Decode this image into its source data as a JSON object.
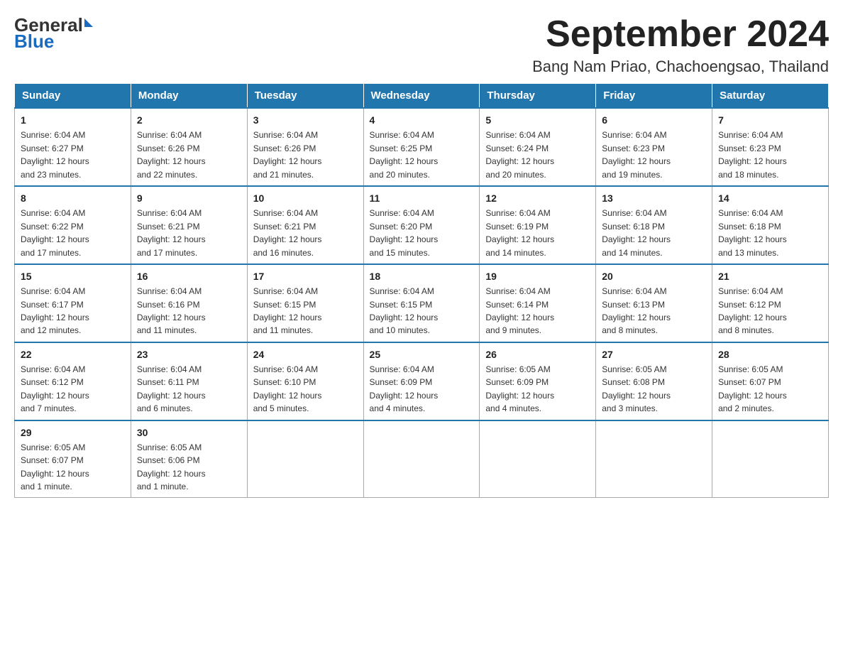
{
  "header": {
    "logo_general": "General",
    "logo_blue": "Blue",
    "month_title": "September 2024",
    "location": "Bang Nam Priao, Chachoengsao, Thailand"
  },
  "weekdays": [
    "Sunday",
    "Monday",
    "Tuesday",
    "Wednesday",
    "Thursday",
    "Friday",
    "Saturday"
  ],
  "weeks": [
    [
      {
        "day": "1",
        "sunrise": "6:04 AM",
        "sunset": "6:27 PM",
        "daylight": "12 hours and 23 minutes."
      },
      {
        "day": "2",
        "sunrise": "6:04 AM",
        "sunset": "6:26 PM",
        "daylight": "12 hours and 22 minutes."
      },
      {
        "day": "3",
        "sunrise": "6:04 AM",
        "sunset": "6:26 PM",
        "daylight": "12 hours and 21 minutes."
      },
      {
        "day": "4",
        "sunrise": "6:04 AM",
        "sunset": "6:25 PM",
        "daylight": "12 hours and 20 minutes."
      },
      {
        "day": "5",
        "sunrise": "6:04 AM",
        "sunset": "6:24 PM",
        "daylight": "12 hours and 20 minutes."
      },
      {
        "day": "6",
        "sunrise": "6:04 AM",
        "sunset": "6:23 PM",
        "daylight": "12 hours and 19 minutes."
      },
      {
        "day": "7",
        "sunrise": "6:04 AM",
        "sunset": "6:23 PM",
        "daylight": "12 hours and 18 minutes."
      }
    ],
    [
      {
        "day": "8",
        "sunrise": "6:04 AM",
        "sunset": "6:22 PM",
        "daylight": "12 hours and 17 minutes."
      },
      {
        "day": "9",
        "sunrise": "6:04 AM",
        "sunset": "6:21 PM",
        "daylight": "12 hours and 17 minutes."
      },
      {
        "day": "10",
        "sunrise": "6:04 AM",
        "sunset": "6:21 PM",
        "daylight": "12 hours and 16 minutes."
      },
      {
        "day": "11",
        "sunrise": "6:04 AM",
        "sunset": "6:20 PM",
        "daylight": "12 hours and 15 minutes."
      },
      {
        "day": "12",
        "sunrise": "6:04 AM",
        "sunset": "6:19 PM",
        "daylight": "12 hours and 14 minutes."
      },
      {
        "day": "13",
        "sunrise": "6:04 AM",
        "sunset": "6:18 PM",
        "daylight": "12 hours and 14 minutes."
      },
      {
        "day": "14",
        "sunrise": "6:04 AM",
        "sunset": "6:18 PM",
        "daylight": "12 hours and 13 minutes."
      }
    ],
    [
      {
        "day": "15",
        "sunrise": "6:04 AM",
        "sunset": "6:17 PM",
        "daylight": "12 hours and 12 minutes."
      },
      {
        "day": "16",
        "sunrise": "6:04 AM",
        "sunset": "6:16 PM",
        "daylight": "12 hours and 11 minutes."
      },
      {
        "day": "17",
        "sunrise": "6:04 AM",
        "sunset": "6:15 PM",
        "daylight": "12 hours and 11 minutes."
      },
      {
        "day": "18",
        "sunrise": "6:04 AM",
        "sunset": "6:15 PM",
        "daylight": "12 hours and 10 minutes."
      },
      {
        "day": "19",
        "sunrise": "6:04 AM",
        "sunset": "6:14 PM",
        "daylight": "12 hours and 9 minutes."
      },
      {
        "day": "20",
        "sunrise": "6:04 AM",
        "sunset": "6:13 PM",
        "daylight": "12 hours and 8 minutes."
      },
      {
        "day": "21",
        "sunrise": "6:04 AM",
        "sunset": "6:12 PM",
        "daylight": "12 hours and 8 minutes."
      }
    ],
    [
      {
        "day": "22",
        "sunrise": "6:04 AM",
        "sunset": "6:12 PM",
        "daylight": "12 hours and 7 minutes."
      },
      {
        "day": "23",
        "sunrise": "6:04 AM",
        "sunset": "6:11 PM",
        "daylight": "12 hours and 6 minutes."
      },
      {
        "day": "24",
        "sunrise": "6:04 AM",
        "sunset": "6:10 PM",
        "daylight": "12 hours and 5 minutes."
      },
      {
        "day": "25",
        "sunrise": "6:04 AM",
        "sunset": "6:09 PM",
        "daylight": "12 hours and 4 minutes."
      },
      {
        "day": "26",
        "sunrise": "6:05 AM",
        "sunset": "6:09 PM",
        "daylight": "12 hours and 4 minutes."
      },
      {
        "day": "27",
        "sunrise": "6:05 AM",
        "sunset": "6:08 PM",
        "daylight": "12 hours and 3 minutes."
      },
      {
        "day": "28",
        "sunrise": "6:05 AM",
        "sunset": "6:07 PM",
        "daylight": "12 hours and 2 minutes."
      }
    ],
    [
      {
        "day": "29",
        "sunrise": "6:05 AM",
        "sunset": "6:07 PM",
        "daylight": "12 hours and 1 minute."
      },
      {
        "day": "30",
        "sunrise": "6:05 AM",
        "sunset": "6:06 PM",
        "daylight": "12 hours and 1 minute."
      },
      null,
      null,
      null,
      null,
      null
    ]
  ],
  "labels": {
    "sunrise": "Sunrise:",
    "sunset": "Sunset:",
    "daylight": "Daylight:"
  }
}
